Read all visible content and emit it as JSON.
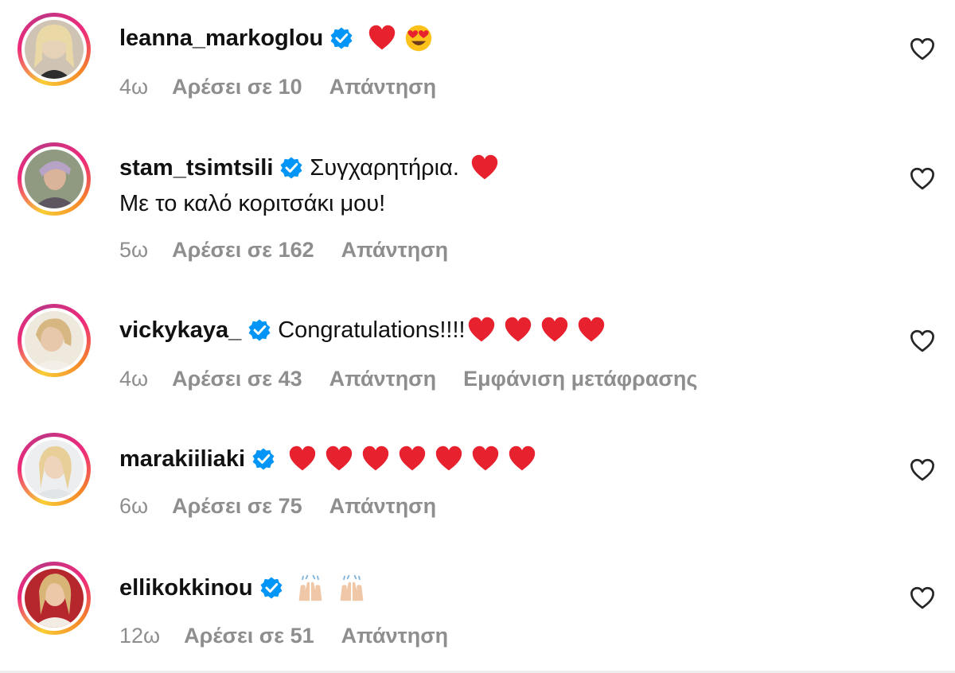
{
  "comments": [
    {
      "username": "leanna_markoglou",
      "text": "",
      "text2": "",
      "emojis": [
        "red-heart",
        "heart-eyes-face"
      ],
      "time": "4ω",
      "likes": "Αρέσει σε 10",
      "reply": "Απάντηση",
      "extra": "",
      "avatar_colors": [
        "#d8c9b8",
        "#e8d8a8",
        "#5a4a3a"
      ]
    },
    {
      "username": "stam_tsimtsili",
      "text": "Συγχαρητήρια.",
      "text2": "Με το καλό κοριτσάκι μου!",
      "emojis": [
        "red-heart"
      ],
      "time": "5ω",
      "likes": "Αρέσει σε 162",
      "reply": "Απάντηση",
      "extra": "",
      "avatar_colors": [
        "#9aa08a",
        "#b8a9c9",
        "#6a5f6a"
      ]
    },
    {
      "username": "vickykaya_",
      "text": "Congratulations!!!!",
      "text2": "",
      "emojis": [
        "red-heart",
        "red-heart",
        "red-heart",
        "red-heart"
      ],
      "time": "4ω",
      "likes": "Αρέσει σε 43",
      "reply": "Απάντηση",
      "extra": "Εμφάνιση μετάφρασης",
      "avatar_colors": [
        "#e8e0d0",
        "#d9c29a",
        "#c8b8a0"
      ]
    },
    {
      "username": "marakiiliaki",
      "text": "",
      "text2": "",
      "emojis": [
        "red-heart",
        "red-heart",
        "red-heart",
        "red-heart",
        "red-heart",
        "red-heart",
        "red-heart"
      ],
      "time": "6ω",
      "likes": "Αρέσει σε 75",
      "reply": "Απάντηση",
      "extra": "",
      "avatar_colors": [
        "#eef0f0",
        "#e8d6a0",
        "#d0d4d8"
      ]
    },
    {
      "username": "ellikokkinou",
      "text": "",
      "text2": "",
      "emojis": [
        "raising-hands",
        "raising-hands"
      ],
      "time": "12ω",
      "likes": "Αρέσει σε 51",
      "reply": "Απάντηση",
      "extra": "",
      "avatar_colors": [
        "#b0222a",
        "#e8c890",
        "#f0e8e0"
      ]
    }
  ],
  "colors": {
    "username": "#111111",
    "meta": "#8e8e8e",
    "verified": "#0095f6",
    "heart": "#e8212f"
  }
}
